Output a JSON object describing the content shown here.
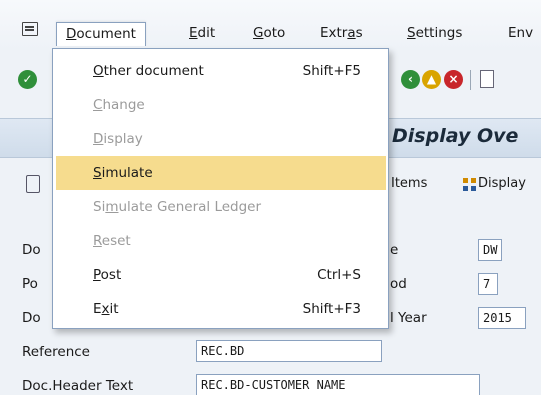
{
  "menubar": {
    "items": [
      {
        "label": "Document",
        "key": "D",
        "rest": "ocument"
      },
      {
        "label": "Edit",
        "key": "E",
        "rest": "dit"
      },
      {
        "label": "Goto",
        "key": "G",
        "rest": "oto"
      },
      {
        "label": "Extras",
        "pre": "Extr",
        "key": "a",
        "rest": "s"
      },
      {
        "label": "Settings",
        "key": "S",
        "rest": "ettings"
      },
      {
        "label": "Env",
        "pre": "",
        "key": "",
        "rest": "Env"
      }
    ]
  },
  "dropdown": {
    "items": [
      {
        "key": "O",
        "rest": "ther document",
        "shortcut": "Shift+F5",
        "enabled": true
      },
      {
        "key": "C",
        "rest": "hange",
        "shortcut": "",
        "enabled": false
      },
      {
        "key": "D",
        "rest": "isplay",
        "shortcut": "",
        "enabled": false
      },
      {
        "key": "S",
        "rest": "imulate",
        "shortcut": "",
        "enabled": true,
        "highlighted": true
      },
      {
        "pre": "Si",
        "key": "m",
        "rest": "ulate General Ledger",
        "shortcut": "",
        "enabled": false
      },
      {
        "key": "R",
        "rest": "eset",
        "shortcut": "",
        "enabled": false
      },
      {
        "key": "P",
        "rest": "ost",
        "shortcut": "Ctrl+S",
        "enabled": true
      },
      {
        "pre": "E",
        "key": "x",
        "rest": "it",
        "shortcut": "Shift+F3",
        "enabled": true
      }
    ]
  },
  "title": {
    "text": "Display Ove"
  },
  "appbar": {
    "items_label": "Items",
    "display_label": "Display"
  },
  "form": {
    "rows": [
      {
        "label": "Do",
        "right_label": "e",
        "value": "DW"
      },
      {
        "label": "Po",
        "right_label": "od",
        "value": "7"
      },
      {
        "label": "Do",
        "right_label": "l Year",
        "value": "2015"
      },
      {
        "label": "Reference",
        "value": "REC.BD"
      },
      {
        "label": "Doc.Header Text",
        "value": "REC.BD-CUSTOMER NAME"
      }
    ]
  },
  "colors": {
    "highlight": "#f6dc8e",
    "disabled": "#9b9b9b",
    "border": "#8aa1bf"
  }
}
